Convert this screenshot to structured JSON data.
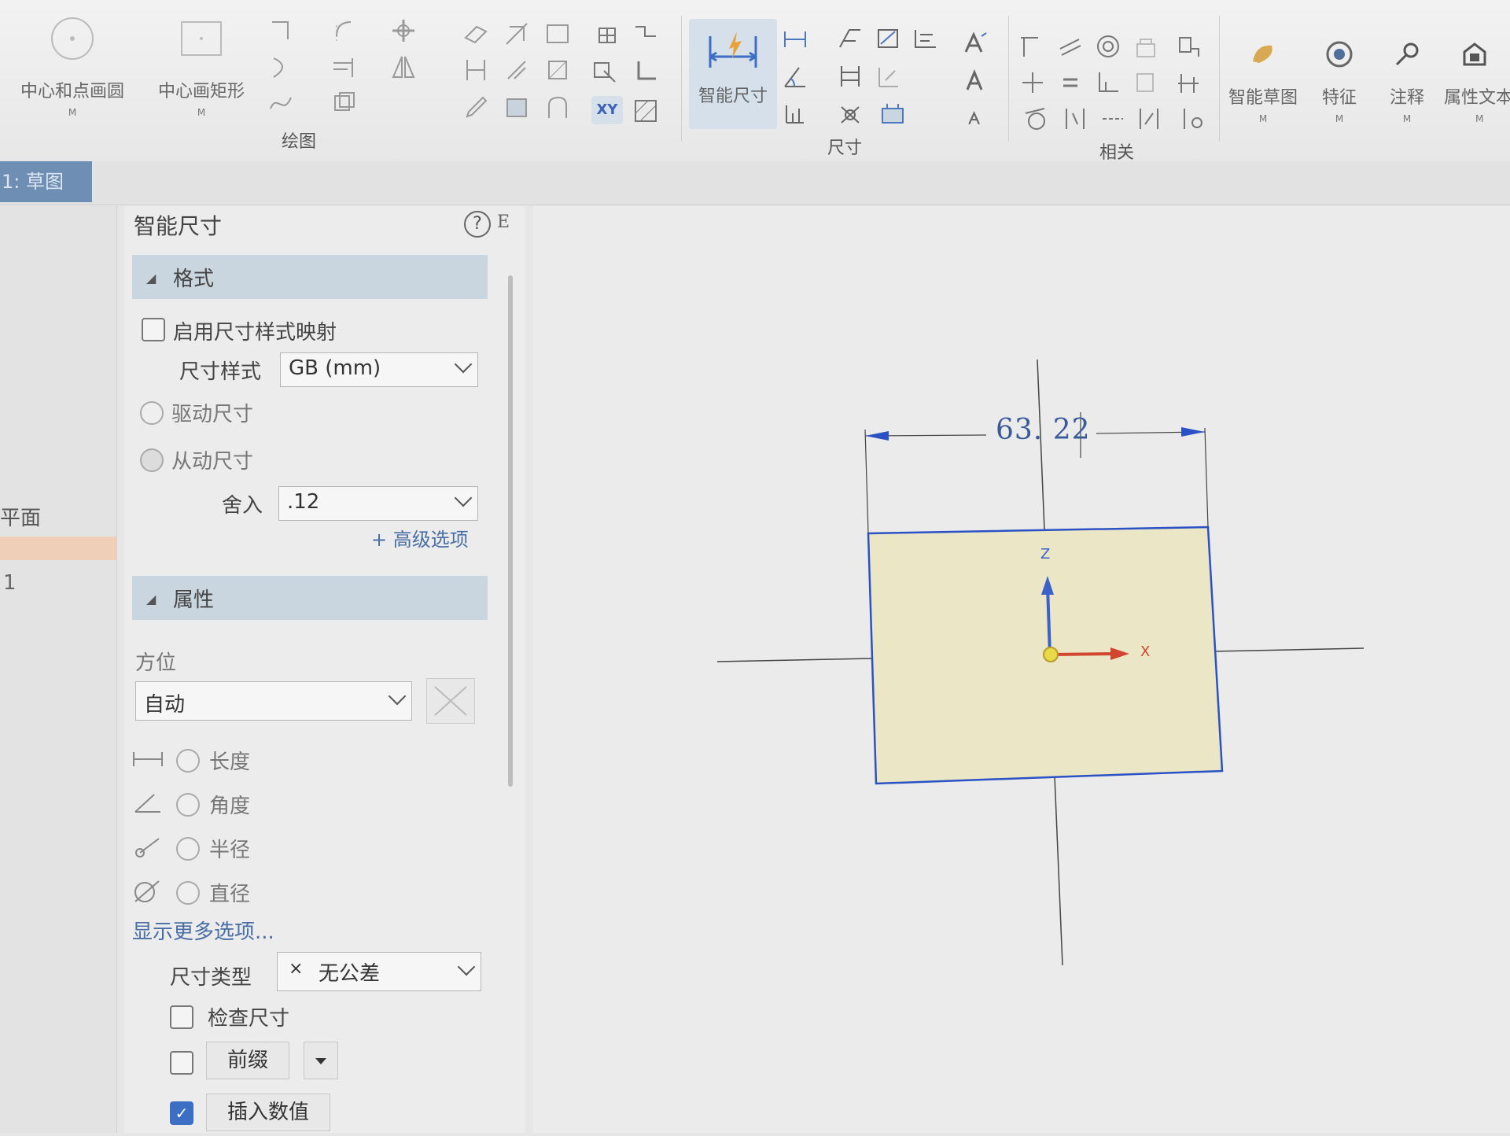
{
  "ribbon": {
    "draw_tools": {
      "circle_label": "中心和点画圆",
      "rect_label": "中心画矩形",
      "more_marker": "M",
      "group_label": "绘图"
    },
    "dimension": {
      "smart_dim_label": "智能尺寸",
      "xy_label": "XY",
      "group_label": "尺寸"
    },
    "relate": {
      "group_label": "相关"
    },
    "right_tools": [
      {
        "label": "智能草图",
        "sub": "M"
      },
      {
        "label": "特征",
        "sub": "M"
      },
      {
        "label": "注释",
        "sub": "M"
      },
      {
        "label": "属性文本",
        "sub": "M"
      }
    ]
  },
  "doc_tab": {
    "label": "1: 草图"
  },
  "left_strip": {
    "label_plane": "平面",
    "label_one": "1"
  },
  "panel": {
    "title": "智能尺寸",
    "help": "?",
    "hotkey": "E",
    "format_section": "格式",
    "enable_mapping_label": "启用尺寸样式映射",
    "dim_style_label": "尺寸样式",
    "dim_style_value": "GB (mm)",
    "driving_label": "驱动尺寸",
    "driven_label": "从动尺寸",
    "round_label": "舍入",
    "round_value": ".12",
    "advanced_link": "+ 高级选项",
    "props_section": "属性",
    "orientation_label": "方位",
    "orientation_value": "自动",
    "opt_length": "长度",
    "opt_angle": "角度",
    "opt_radius": "半径",
    "opt_diameter": "直径",
    "more_options_link": "显示更多选项...",
    "dim_type_label": "尺寸类型",
    "dim_type_icon": "×",
    "dim_type_value": "无公差",
    "check_dim_label": "检查尺寸",
    "prefix_button": "前缀",
    "insert_value_button": "插入数值",
    "insert_value_checked": true
  },
  "canvas": {
    "dimension_text": "63. 22",
    "axis_z": "Z",
    "axis_x": "X",
    "rect_fill": "#ebe6c6",
    "rect_stroke": "#2b52c4"
  }
}
